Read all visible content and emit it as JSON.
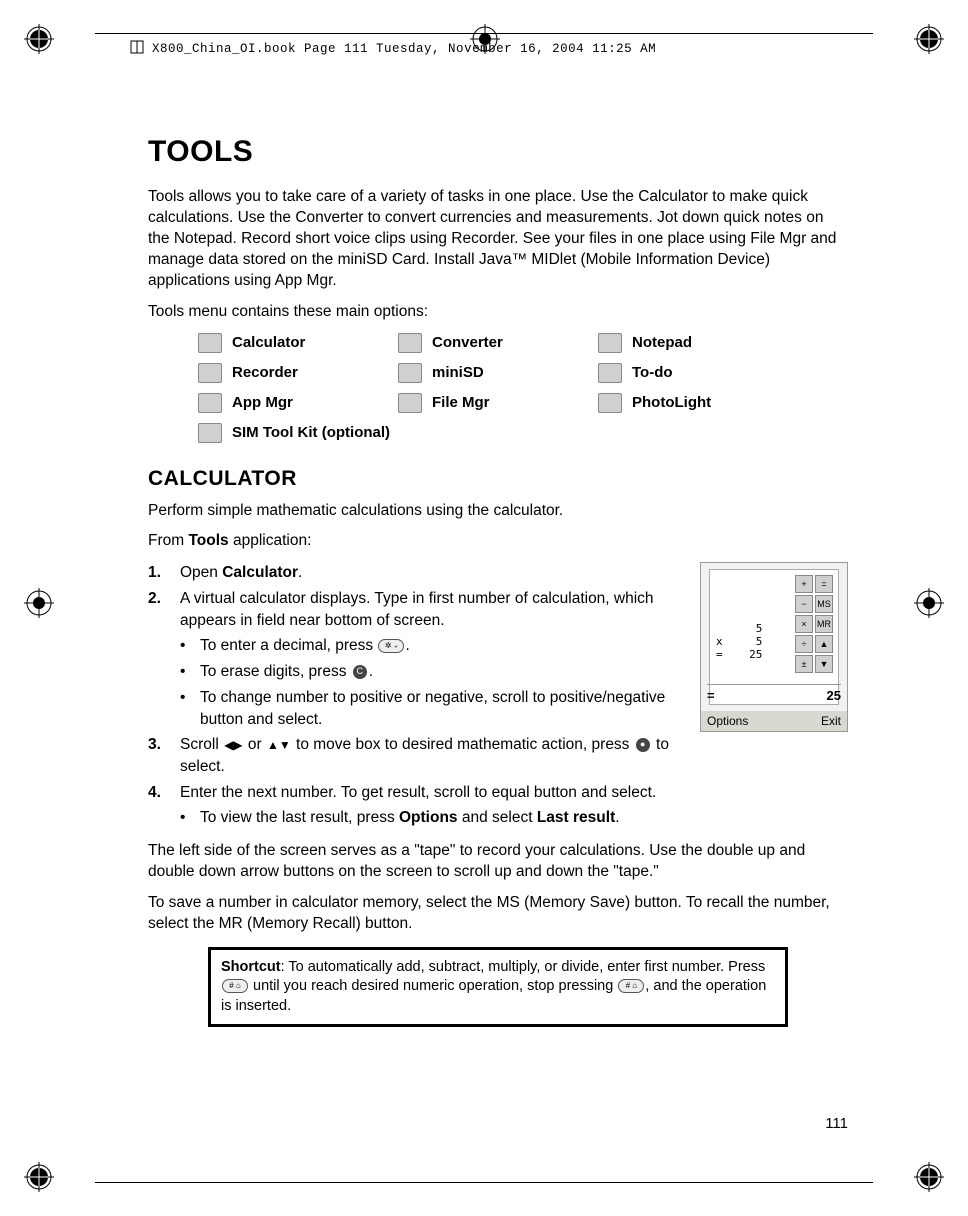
{
  "header": {
    "filename": "X800_China_OI.book  Page 111  Tuesday, November 16, 2004  11:25 AM"
  },
  "title": "TOOLS",
  "intro": "Tools allows you to take care of a variety of tasks in one place. Use the Calculator to make quick calculations. Use the Converter to convert currencies and measurements. Jot down quick notes on the Notepad. Record short voice clips using Recorder. See your files in one place using File Mgr and manage data stored on the miniSD Card. Install Java™ MIDlet (Mobile Information Device) applications using App Mgr.",
  "menu_line": "Tools menu contains these main options:",
  "tools": {
    "r1c1": "Calculator",
    "r1c2": "Converter",
    "r1c3": "Notepad",
    "r2c1": "Recorder",
    "r2c2": "miniSD",
    "r2c3": "To-do",
    "r3c1": "App Mgr",
    "r3c2": "File Mgr",
    "r3c3": "PhotoLight",
    "r4c1": "SIM Tool Kit (optional)"
  },
  "section": "CALCULATOR",
  "calc_intro": "Perform simple mathematic calculations using the calculator.",
  "from_line_pre": "From ",
  "from_line_bold": "Tools",
  "from_line_post": " application:",
  "s1_pre": "Open ",
  "s1_bold": "Calculator",
  "s1_post": ".",
  "s2": "A virtual calculator displays. Type in first number of calculation, which appears in field near bottom of screen.",
  "b1_pre": "To enter a decimal, press ",
  "b1_post": ".",
  "b2_pre": "To erase digits, press ",
  "b2_post": ".",
  "b3": "To change number to positive or negative, scroll to positive/negative button and select.",
  "s3_pre": "Scroll ",
  "s3_mid1": " or ",
  "s3_mid2": " to move box to desired mathematic action, press ",
  "s3_post": " to select.",
  "s4": "Enter the next number. To get result, scroll to equal button and select.",
  "b4_pre": "To view the last result, press ",
  "b4_bold1": "Options",
  "b4_mid": " and select ",
  "b4_bold2": "Last result",
  "b4_post": ".",
  "tape_para": "The left side of the screen serves as a \"tape\" to record your calculations. Use the double up and double down arrow buttons on the screen to scroll up and down the \"tape.\"",
  "mem_para": "To save a number in calculator memory, select the MS (Memory Save) button. To recall the number, select the MR (Memory Recall) button.",
  "shortcut_label": "Shortcut",
  "shortcut_pre": ":  To automatically add, subtract, multiply, or divide, enter first number. Press ",
  "shortcut_mid": " until you reach desired numeric operation, stop pressing ",
  "shortcut_post": ", and the operation is inserted.",
  "calc_screenshot": {
    "tape_line1": "      5",
    "tape_line2": "x     5",
    "tape_line3": "=    25",
    "result_eq": "=",
    "result_val": "25",
    "soft_left": "Options",
    "soft_right": "Exit",
    "keys": [
      "+",
      "=",
      "−",
      "MS",
      "×",
      "MR",
      "÷",
      "▲",
      "±",
      "▼"
    ]
  },
  "page_number": "111"
}
